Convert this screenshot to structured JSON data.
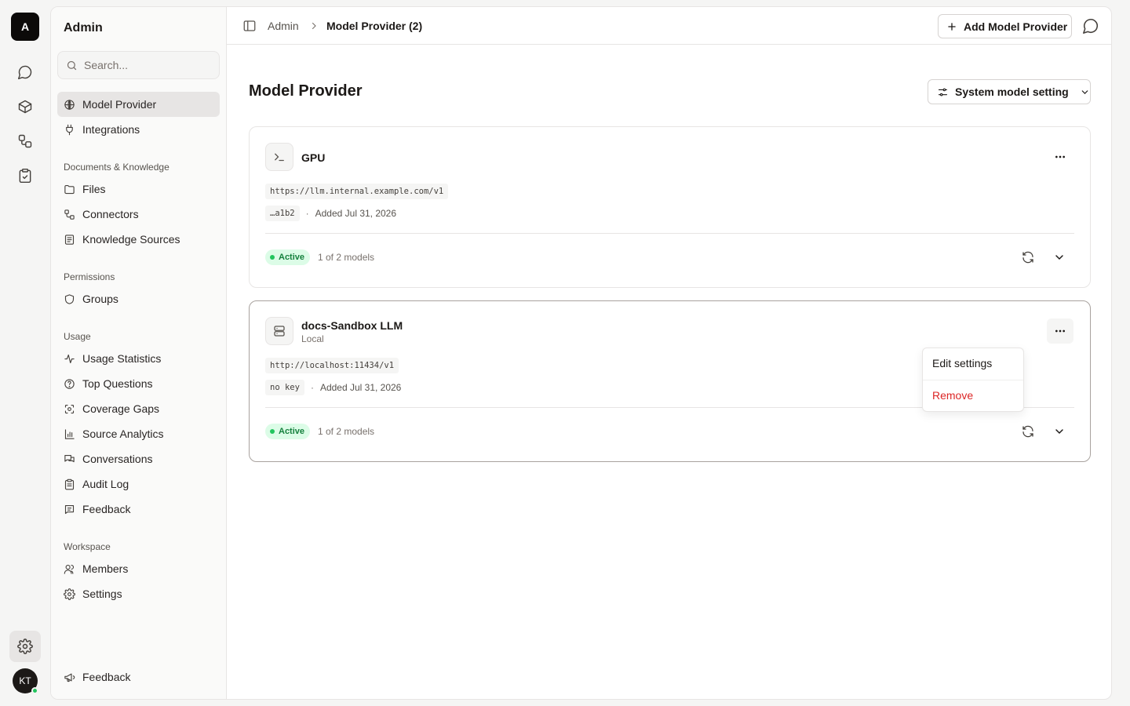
{
  "rail": {
    "logo_letter": "A",
    "avatar_initials": "KT"
  },
  "sidebar": {
    "title": "Admin",
    "search_placeholder": "Search...",
    "top_items": [
      {
        "label": "Model Provider",
        "icon": "globe-icon",
        "active": true
      },
      {
        "label": "Integrations",
        "icon": "plug-icon",
        "active": false
      }
    ],
    "sections": [
      {
        "label": "Documents & Knowledge",
        "items": [
          {
            "label": "Files",
            "icon": "folder-icon"
          },
          {
            "label": "Connectors",
            "icon": "connector-icon"
          },
          {
            "label": "Knowledge Sources",
            "icon": "book-icon"
          }
        ]
      },
      {
        "label": "Permissions",
        "items": [
          {
            "label": "Groups",
            "icon": "shield-icon"
          }
        ]
      },
      {
        "label": "Usage",
        "items": [
          {
            "label": "Usage Statistics",
            "icon": "activity-icon"
          },
          {
            "label": "Top Questions",
            "icon": "help-circle-icon"
          },
          {
            "label": "Coverage Gaps",
            "icon": "scan-icon"
          },
          {
            "label": "Source Analytics",
            "icon": "bar-chart-icon"
          },
          {
            "label": "Conversations",
            "icon": "messages-icon"
          },
          {
            "label": "Audit Log",
            "icon": "clipboard-icon"
          },
          {
            "label": "Feedback",
            "icon": "message-text-icon"
          }
        ]
      },
      {
        "label": "Workspace",
        "items": [
          {
            "label": "Members",
            "icon": "users-icon"
          },
          {
            "label": "Settings",
            "icon": "gear-icon"
          }
        ]
      }
    ],
    "footer_feedback": "Feedback"
  },
  "topbar": {
    "breadcrumb_root": "Admin",
    "breadcrumb_current": "Model Provider (2)",
    "add_button": "Add Model Provider"
  },
  "page": {
    "title": "Model Provider",
    "system_setting_button": "System model setting"
  },
  "providers": [
    {
      "name": "GPU",
      "subtitle": "",
      "icon": "terminal-icon",
      "url": "https://llm.internal.example.com/v1",
      "key": "…a1b2",
      "added": "Added Jul 31, 2026",
      "status": "Active",
      "models": "1 of 2 models"
    },
    {
      "name": "docs-Sandbox LLM",
      "subtitle": "Local",
      "icon": "server-icon",
      "url": "http://localhost:11434/v1",
      "key": "no key",
      "added": "Added Jul 31, 2026",
      "status": "Active",
      "models": "1 of 2 models"
    }
  ],
  "dropdown": {
    "edit": "Edit settings",
    "remove": "Remove"
  },
  "colors": {
    "accent_dark": "#0c0a09",
    "active_green": "#15803d",
    "active_bg": "#dcfce7",
    "danger": "#dc2626"
  }
}
